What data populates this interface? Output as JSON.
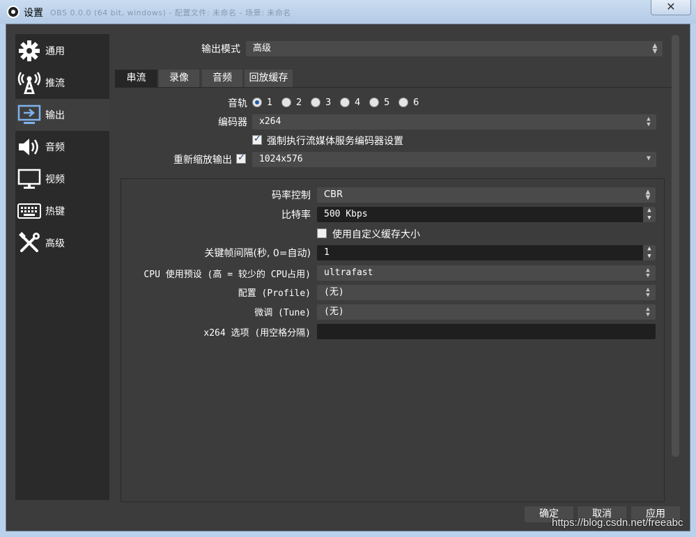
{
  "window": {
    "title": "设置",
    "blurred_title": "OBS 0.0.0 (64 bit, windows) - 配置文件: 未命名 - 场景: 未命名",
    "close_glyph": "✕"
  },
  "sidebar": {
    "items": [
      {
        "label": "通用",
        "icon": "gear-icon"
      },
      {
        "label": "推流",
        "icon": "broadcast-icon"
      },
      {
        "label": "输出",
        "icon": "output-icon"
      },
      {
        "label": "音频",
        "icon": "speaker-icon"
      },
      {
        "label": "视频",
        "icon": "monitor-icon"
      },
      {
        "label": "热键",
        "icon": "keyboard-icon"
      },
      {
        "label": "高级",
        "icon": "tools-icon"
      }
    ],
    "active_index": 2
  },
  "output_mode": {
    "label": "输出模式",
    "value": "高级"
  },
  "tabs": [
    {
      "label": "串流",
      "active": true
    },
    {
      "label": "录像",
      "active": false
    },
    {
      "label": "音频",
      "active": false
    },
    {
      "label": "回放缓存",
      "active": false
    }
  ],
  "audio_track": {
    "label": "音轨",
    "options": [
      "1",
      "2",
      "3",
      "4",
      "5",
      "6"
    ],
    "selected": "1"
  },
  "encoder": {
    "label": "编码器",
    "value": "x264"
  },
  "enforce": {
    "label": "强制执行流媒体服务编码器设置",
    "checked": true
  },
  "rescale": {
    "label": "重新缩放输出",
    "checked": true,
    "value": "1024x576"
  },
  "encoder_settings": {
    "rate_control": {
      "label": "码率控制",
      "value": "CBR"
    },
    "bitrate": {
      "label": "比特率",
      "value": "500 Kbps"
    },
    "custom_buffer": {
      "label": "使用自定义缓存大小",
      "checked": false
    },
    "keyframe": {
      "label": "关键帧间隔(秒, 0=自动)",
      "value": "1"
    },
    "cpu_preset": {
      "label": "CPU 使用预设 (高 = 较少的 CPU占用)",
      "value": "ultrafast"
    },
    "profile": {
      "label": "配置 (Profile)",
      "value": "(无)"
    },
    "tune": {
      "label": "微调 (Tune)",
      "value": "(无)"
    },
    "x264_opts": {
      "label": "x264 选项 (用空格分隔)",
      "value": ""
    }
  },
  "buttons": {
    "ok": "确定",
    "cancel": "取消",
    "apply": "应用"
  },
  "watermark": "https://blog.csdn.net/freeabc"
}
